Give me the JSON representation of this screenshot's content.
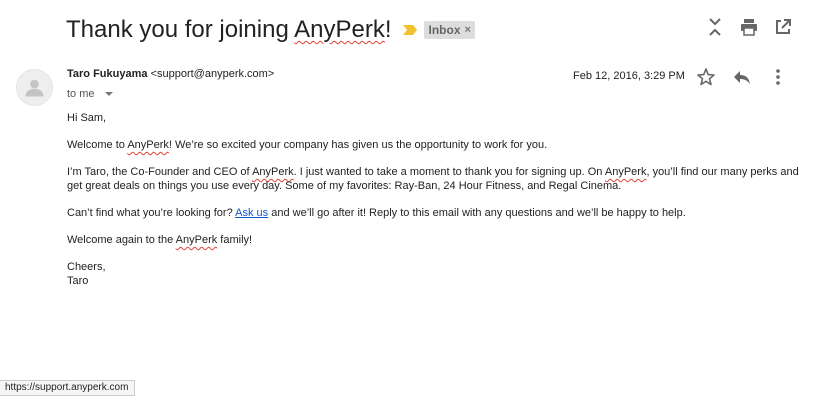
{
  "email": {
    "subject_prefix": "Thank you for joining ",
    "subject_brand": "AnyPerk",
    "subject_suffix": "!",
    "label": "Inbox",
    "label_remove": "×",
    "importance_color": "#f2c12e"
  },
  "toolbar": {
    "icons": [
      "collapse-all-icon",
      "print-icon",
      "open-in-new-window-icon"
    ]
  },
  "sender": {
    "name": "Taro Fukuyama",
    "email": "<support@anyperk.com>",
    "recipient": "to me",
    "date": "Feb 12, 2016, 3:29 PM"
  },
  "message_actions": {
    "icons": [
      "star-icon",
      "reply-icon",
      "more-vert-icon"
    ]
  },
  "body": {
    "greeting": "Hi Sam,",
    "p1_a": "Welcome to ",
    "p1_brand": "AnyPerk",
    "p1_b": "! We’re so excited your company has given us the opportunity to work for you.",
    "p2_a": "I’m Taro, the Co-Founder and CEO of ",
    "p2_brand1": "AnyPerk",
    "p2_b": ". I just wanted to take a moment to thank you for signing up. On ",
    "p2_brand2": "AnyPerk",
    "p2_c": ", you’ll find our many perks and get great deals on things you use every day. Some of my favorites: Ray-Ban, 24 Hour Fitness, and Regal Cinema.",
    "p3_a": "Can’t find what you’re looking for? ",
    "p3_link": "Ask us",
    "p3_b": " and we’ll go after it! Reply to this email with any questions and we’ll be happy to help.",
    "p4_a": "Welcome again to the ",
    "p4_brand": "AnyPerk",
    "p4_b": " family!",
    "signoff": "Cheers,",
    "signature": "Taro"
  },
  "statusbar": {
    "url": "https://support.anyperk.com"
  },
  "colors": {
    "link": "#1155cc",
    "chip_bg": "#dddddd",
    "icon": "#666666"
  }
}
